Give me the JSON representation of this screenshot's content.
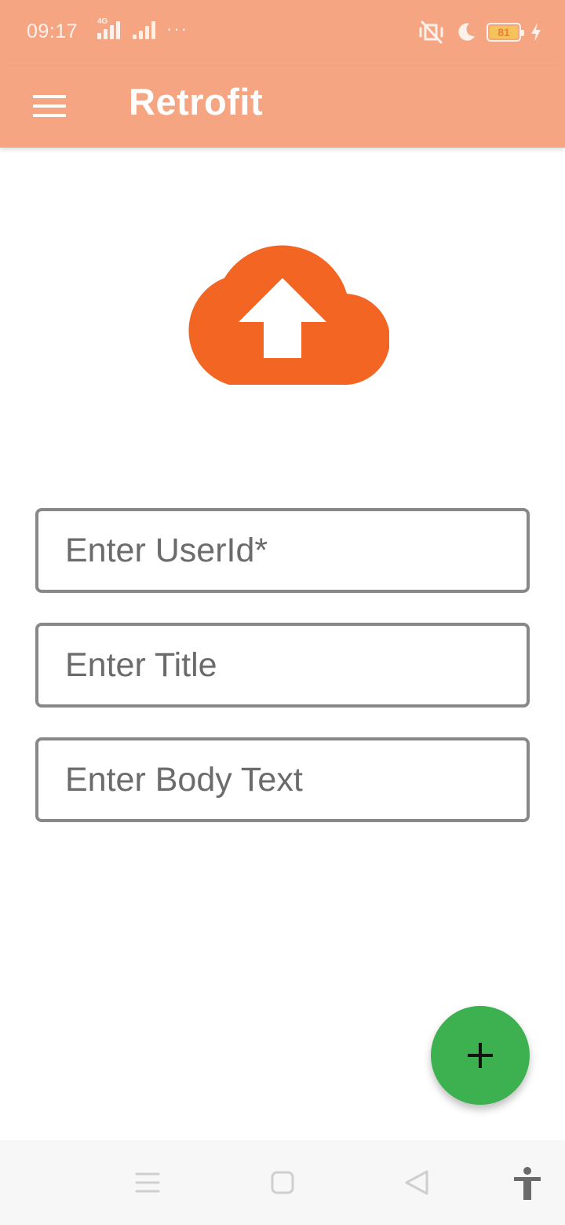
{
  "status_bar": {
    "time": "09:17",
    "network_type": "4G",
    "battery_level": "81",
    "icons": [
      "signal-icon",
      "signal-icon",
      "more-icon",
      "vibrate-icon",
      "moon-icon",
      "battery-icon",
      "charging-icon"
    ]
  },
  "app_bar": {
    "title": "Retrofit",
    "menu_icon": "hamburger-menu-icon"
  },
  "hero": {
    "icon": "cloud-upload-icon",
    "color": "#F26522"
  },
  "form": {
    "user_id_placeholder": "Enter UserId*",
    "title_placeholder": "Enter Title",
    "body_placeholder": "Enter Body Text"
  },
  "fab": {
    "icon": "plus-icon",
    "color": "#3DB050"
  },
  "nav_bar": {
    "icons": [
      "recents-icon",
      "home-icon",
      "back-icon",
      "accessibility-icon"
    ]
  },
  "colors": {
    "app_bar": "#F6A583",
    "field_border": "#888888",
    "background": "#FFFFFF"
  }
}
